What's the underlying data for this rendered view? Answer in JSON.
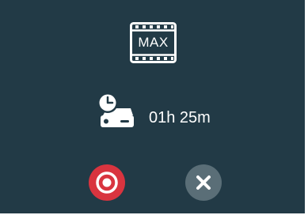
{
  "mode": {
    "icon": "film-frame-icon",
    "label": "MAX"
  },
  "storage": {
    "icon": "storage-clock-icon",
    "remaining_time": "01h 25m"
  },
  "controls": {
    "record_icon": "record-icon",
    "cancel_icon": "close-icon"
  },
  "colors": {
    "background": "#223a46",
    "record": "#d9343f",
    "cancel": "#5a6e77",
    "foreground": "#ffffff"
  }
}
